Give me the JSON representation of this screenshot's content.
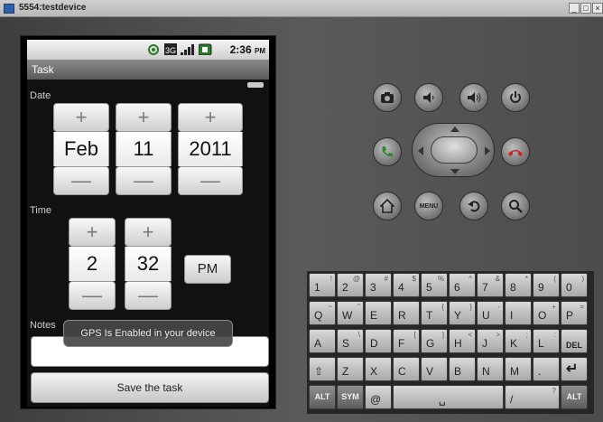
{
  "window": {
    "title": "5554:testdevice",
    "buttons": [
      "_",
      "□",
      "×"
    ]
  },
  "status_bar": {
    "time": "2:36",
    "ampm": "PM",
    "network": "3G"
  },
  "app": {
    "title": "Task"
  },
  "form": {
    "date_label": "Date",
    "time_label": "Time",
    "notes_label": "Notes",
    "notes_value": "",
    "date": {
      "month": "Feb",
      "day": "11",
      "year": "2011"
    },
    "time": {
      "hour": "2",
      "minute": "32",
      "ampm": "PM"
    },
    "increment_symbol": "+",
    "decrement_symbol": "—",
    "save_label": "Save the task"
  },
  "toast": "GPS Is Enabled in your device",
  "controls": {
    "menu_label": "MENU",
    "icons": [
      "camera-icon",
      "volume-down-icon",
      "volume-up-icon",
      "power-icon",
      "call-icon",
      "end-call-icon",
      "home-icon",
      "menu-icon",
      "back-icon",
      "search-icon"
    ]
  },
  "keyboard": {
    "rows": [
      [
        {
          "main": "1",
          "alt": "!"
        },
        {
          "main": "2",
          "alt": "@"
        },
        {
          "main": "3",
          "alt": "#"
        },
        {
          "main": "4",
          "alt": "$"
        },
        {
          "main": "5",
          "alt": "%"
        },
        {
          "main": "6",
          "alt": "^"
        },
        {
          "main": "7",
          "alt": "&"
        },
        {
          "main": "8",
          "alt": "*"
        },
        {
          "main": "9",
          "alt": "("
        },
        {
          "main": "0",
          "alt": ")"
        }
      ],
      [
        {
          "main": "Q",
          "alt": "~"
        },
        {
          "main": "W",
          "alt": "\""
        },
        {
          "main": "E",
          "alt": ""
        },
        {
          "main": "R",
          "alt": ""
        },
        {
          "main": "T",
          "alt": "{"
        },
        {
          "main": "Y",
          "alt": "}"
        },
        {
          "main": "U",
          "alt": "-"
        },
        {
          "main": "I",
          "alt": ""
        },
        {
          "main": "O",
          "alt": "+"
        },
        {
          "main": "P",
          "alt": "="
        }
      ],
      [
        {
          "main": "A",
          "alt": ""
        },
        {
          "main": "S",
          "alt": "\\"
        },
        {
          "main": "D",
          "alt": ""
        },
        {
          "main": "F",
          "alt": "["
        },
        {
          "main": "G",
          "alt": "]"
        },
        {
          "main": "H",
          "alt": "<"
        },
        {
          "main": "J",
          "alt": ">"
        },
        {
          "main": "K",
          "alt": ";"
        },
        {
          "main": "L",
          "alt": ":"
        },
        {
          "main": "DEL",
          "alt": ""
        }
      ],
      [
        {
          "main": "⇧",
          "alt": ""
        },
        {
          "main": "Z",
          "alt": ""
        },
        {
          "main": "X",
          "alt": ""
        },
        {
          "main": "C",
          "alt": ""
        },
        {
          "main": "V",
          "alt": ""
        },
        {
          "main": "B",
          "alt": ""
        },
        {
          "main": "N",
          "alt": ""
        },
        {
          "main": "M",
          "alt": ""
        },
        {
          "main": ".",
          "alt": ""
        },
        {
          "main": "↵",
          "alt": ""
        }
      ],
      [
        {
          "main": "ALT",
          "alt": ""
        },
        {
          "main": "SYM",
          "alt": ""
        },
        {
          "main": "@",
          "alt": ""
        },
        {
          "main": "␣",
          "alt": ""
        },
        {
          "main": "/",
          "alt": "?"
        },
        {
          "main": "ALT",
          "alt": ""
        }
      ]
    ]
  },
  "colors": {
    "call_green": "#2f8a2f",
    "end_red": "#c62828",
    "toast_bg": "#464646"
  }
}
